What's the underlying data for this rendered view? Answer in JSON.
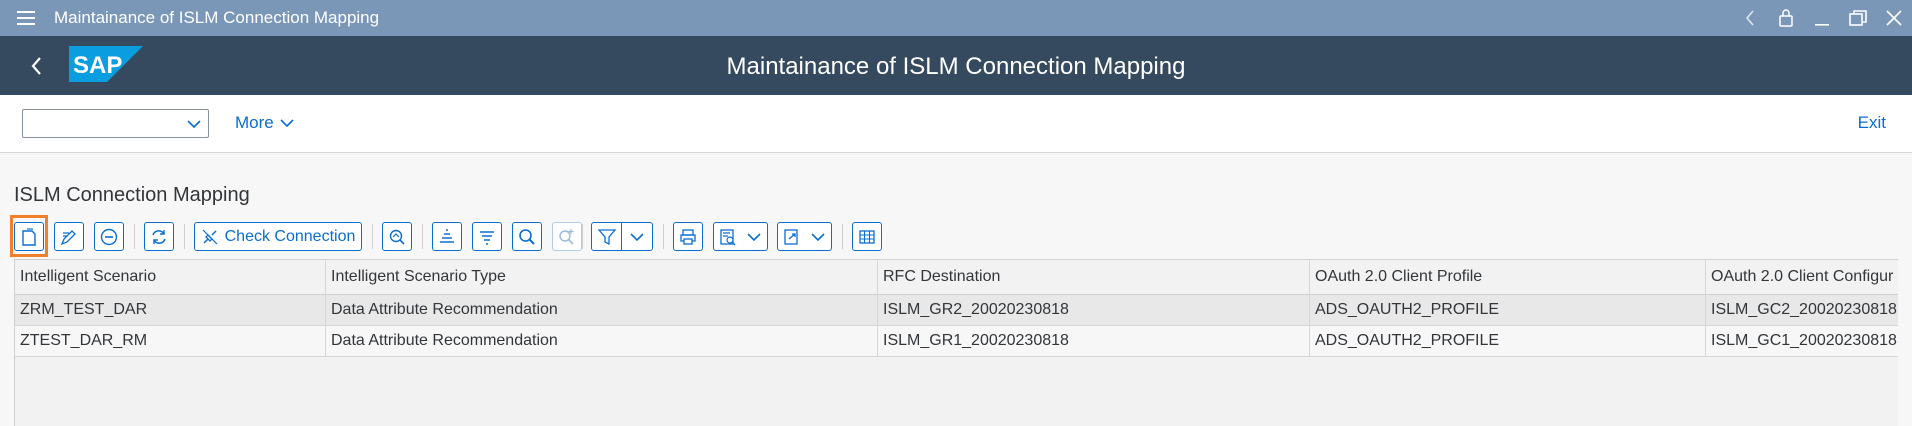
{
  "window": {
    "title": "Maintainance of ISLM Connection Mapping"
  },
  "shell": {
    "title": "Maintainance of ISLM Connection Mapping",
    "logo_text": "SAP"
  },
  "app_toolbar": {
    "command_value": "",
    "more_label": "More",
    "exit_label": "Exit"
  },
  "section": {
    "title": "ISLM Connection Mapping"
  },
  "toolbar": {
    "check_connection_label": "Check Connection"
  },
  "grid": {
    "columns": [
      "Intelligent Scenario",
      "Intelligent Scenario Type",
      "RFC Destination",
      "OAuth 2.0 Client Profile",
      "OAuth 2.0 Client Configur"
    ],
    "rows": [
      [
        "ZRM_TEST_DAR",
        "Data Attribute Recommendation",
        "ISLM_GR2_20020230818",
        "ADS_OAUTH2_PROFILE",
        "ISLM_GC2_20020230818"
      ],
      [
        "ZTEST_DAR_RM",
        "Data Attribute Recommendation",
        "ISLM_GR1_20020230818",
        "ADS_OAUTH2_PROFILE",
        "ISLM_GC1_20020230818"
      ]
    ]
  },
  "colors": {
    "title_bar": "#7b97b7",
    "shell_bar": "#354a5f",
    "accent": "#0a6ed1",
    "focus": "#f0802a",
    "sap_blue": "#0a9ee0"
  }
}
